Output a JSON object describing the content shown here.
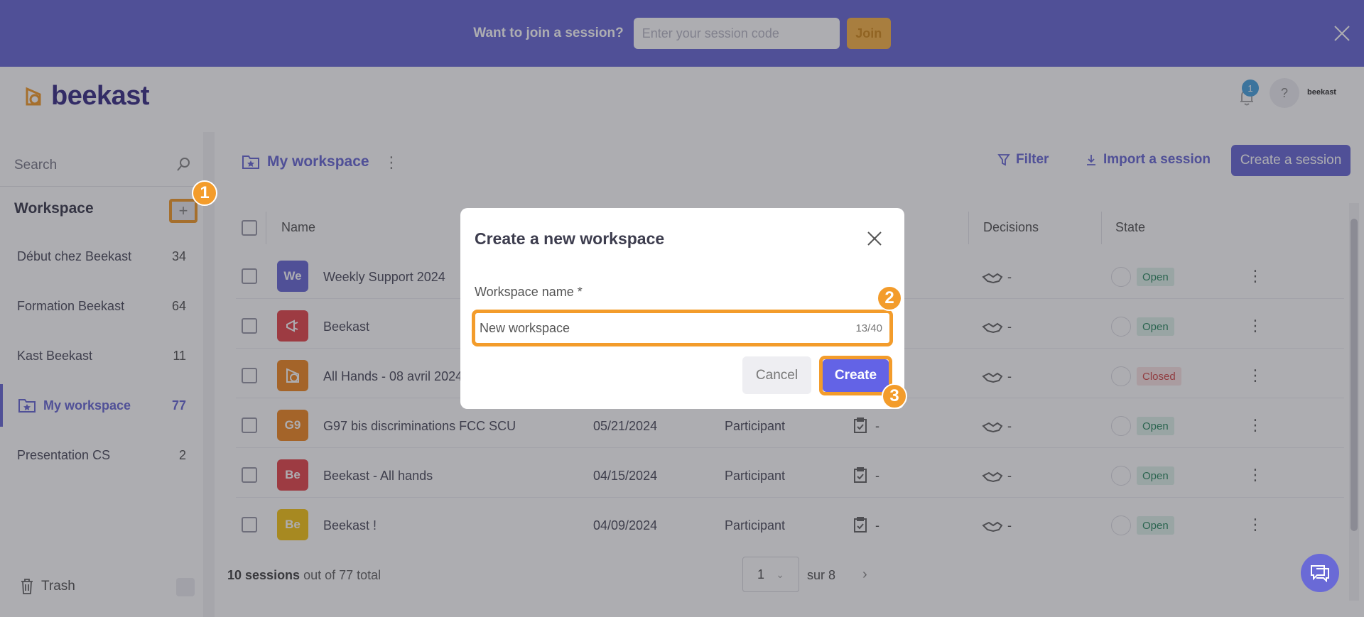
{
  "banner": {
    "prompt": "Want to join a session?",
    "code_placeholder": "Enter your session code",
    "join_label": "Join"
  },
  "header": {
    "logo_text": "beekast",
    "notification_count": "1",
    "help_label": "?",
    "account_label": "beekast"
  },
  "sidebar": {
    "search_label": "Search",
    "workspace_title": "Workspace",
    "add_label": "+",
    "items": [
      {
        "label": "Début chez Beekast",
        "count": "34"
      },
      {
        "label": "Formation Beekast",
        "count": "64"
      },
      {
        "label": "Kast Beekast",
        "count": "11"
      },
      {
        "label": "My workspace",
        "count": "77",
        "active": true
      },
      {
        "label": "Presentation CS",
        "count": "2"
      }
    ],
    "trash_label": "Trash"
  },
  "main": {
    "title": "My workspace",
    "filter_label": "Filter",
    "import_label": "Import a session",
    "create_label": "Create a session",
    "columns": {
      "name": "Name",
      "decisions": "Decisions",
      "state": "State"
    },
    "rows": [
      {
        "initials": "We",
        "color": "#6a6ad6",
        "name": "Weekly Support 2024",
        "date": "",
        "role": "",
        "state": "Open"
      },
      {
        "initials": "",
        "color": "#e5484d",
        "name": "Beekast",
        "date": "",
        "role": "",
        "state": "Open"
      },
      {
        "initials": "",
        "color": "#f08a24",
        "name": "All Hands - 08 avril 2024",
        "date": "",
        "role": "",
        "state": "Closed"
      },
      {
        "initials": "G9",
        "color": "#f08a24",
        "name": "G97 bis discriminations FCC SCU",
        "date": "05/21/2024",
        "role": "Participant",
        "state": "Open"
      },
      {
        "initials": "Be",
        "color": "#e5484d",
        "name": "Beekast - All hands",
        "date": "04/15/2024",
        "role": "Participant",
        "state": "Open"
      },
      {
        "initials": "Be",
        "color": "#f5c518",
        "name": "Beekast !",
        "date": "04/09/2024",
        "role": "Participant",
        "state": "Open"
      }
    ],
    "dash": "-",
    "footer": {
      "count_bold": "10 sessions",
      "count_rest": "out of 77 total",
      "page": "1",
      "of_label": "sur 8"
    }
  },
  "modal": {
    "title": "Create a new workspace",
    "field_label": "Workspace name *",
    "field_value": "New workspace",
    "counter": "13/40",
    "cancel_label": "Cancel",
    "create_label": "Create"
  },
  "markers": [
    "1",
    "2",
    "3"
  ],
  "colors": {
    "accent": "#6a6ad6",
    "highlight": "#f39c2b",
    "join": "#f7b347"
  }
}
